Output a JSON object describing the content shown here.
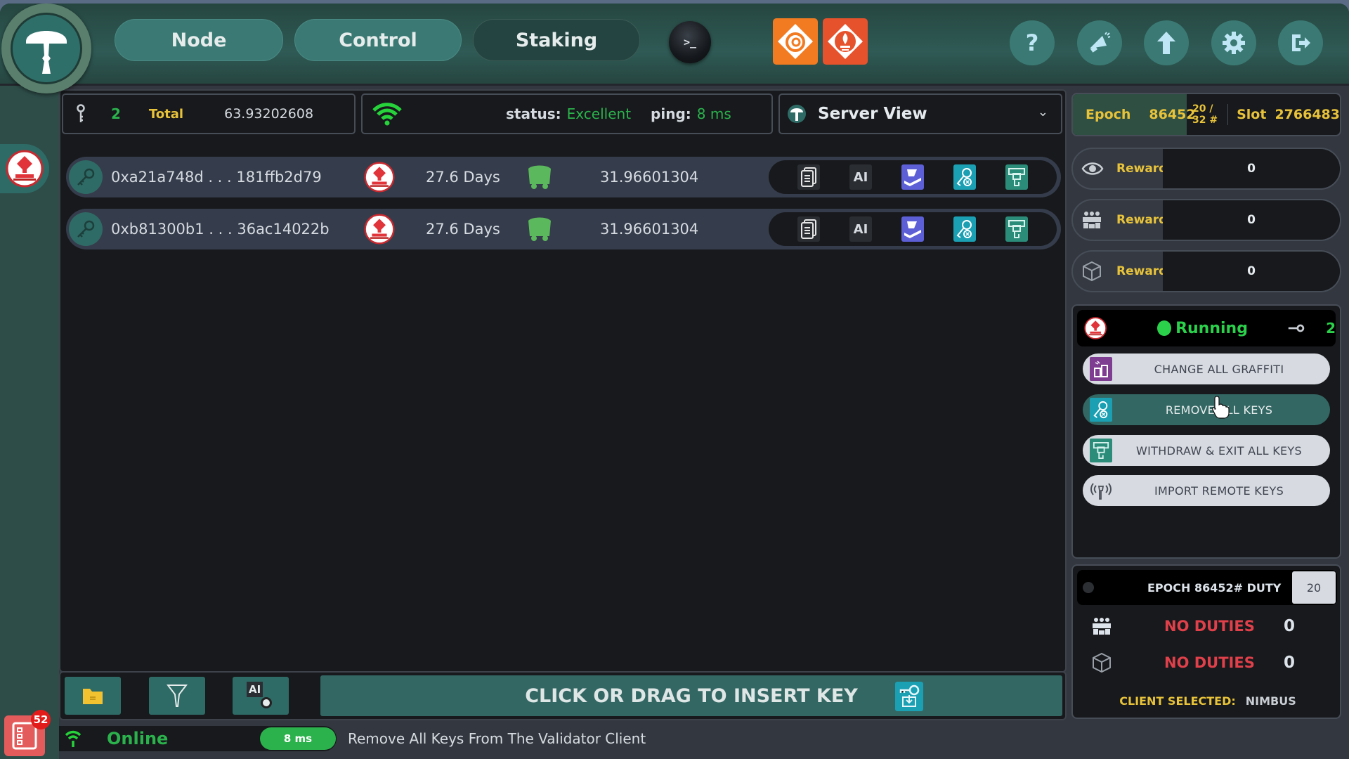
{
  "topbar": {
    "tabs": [
      {
        "label": "Node",
        "active": false
      },
      {
        "label": "Control",
        "active": false
      },
      {
        "label": "Staking",
        "active": true
      }
    ],
    "terminal_label": ">_",
    "plugins": [
      {
        "name": "grafana",
        "color": "#f27b21"
      },
      {
        "name": "prometheus",
        "color": "#e6522c"
      }
    ],
    "right_icons": [
      "help-icon",
      "announcement-icon",
      "update-icon",
      "settings-icon",
      "logout-icon"
    ],
    "help_glyph": "?"
  },
  "infobar": {
    "key_count": "2",
    "total_label": "Total",
    "total_value": "63.93202608",
    "status_label": "status:",
    "status_value": "Excellent",
    "ping_label": "ping:",
    "ping_value": "8 ms",
    "view_selector": "Server View"
  },
  "epoch": {
    "epoch_label": "Epoch",
    "epoch_value": "86452",
    "slot_progress": "20 / 32 #",
    "slot_label": "Slot",
    "slot_value": "2766483"
  },
  "keys": [
    {
      "pubkey": "0xa21a748d . . . 181ffb2d79",
      "age": "27.6 Days",
      "balance": "31.96601304"
    },
    {
      "pubkey": "0xb81300b1 . . . 36ac14022b",
      "age": "27.6 Days",
      "balance": "31.96601304"
    }
  ],
  "key_actions": {
    "ai_label": "AI"
  },
  "rewards": [
    {
      "icon": "eye-icon",
      "label": "Reward",
      "value": "0"
    },
    {
      "icon": "committee-icon",
      "label": "Reward",
      "value": "0"
    },
    {
      "icon": "block-icon",
      "label": "Reward",
      "value": "0"
    }
  ],
  "client": {
    "status": "Running",
    "key_count": "2",
    "buttons": [
      {
        "label": "CHANGE ALL GRAFFITI",
        "color": "#7e3d91",
        "active": false
      },
      {
        "label": "REMOVE ALL KEYS",
        "color": "#1a9fb3",
        "active": true
      },
      {
        "label": "WITHDRAW & EXIT ALL KEYS",
        "color": "#2c8c7a",
        "active": false
      },
      {
        "label": "IMPORT REMOTE KEYS",
        "color": "#d7dbe1",
        "active": false
      }
    ]
  },
  "duty": {
    "title": "EPOCH 86452# DUTY",
    "slot_input": "20",
    "rows": [
      {
        "icon": "committee-icon",
        "label": "NO DUTIES",
        "count": "0"
      },
      {
        "icon": "block-icon",
        "label": "NO DUTIES",
        "count": "0"
      }
    ],
    "client_selected_label": "CLIENT SELECTED:",
    "client_selected_value": "NIMBUS"
  },
  "toolbar": {
    "ai_label": "AI",
    "drop_zone_label": "CLICK OR DRAG TO INSERT KEY"
  },
  "statusbar": {
    "connection": "Online",
    "ping": "8 ms",
    "message": "Remove All Keys From The Validator Client"
  },
  "notifications": {
    "count": "52"
  },
  "colors": {
    "accent_teal": "#336763",
    "status_green": "#2bb24c",
    "gold": "#e8c33a",
    "danger": "#e0404a"
  }
}
